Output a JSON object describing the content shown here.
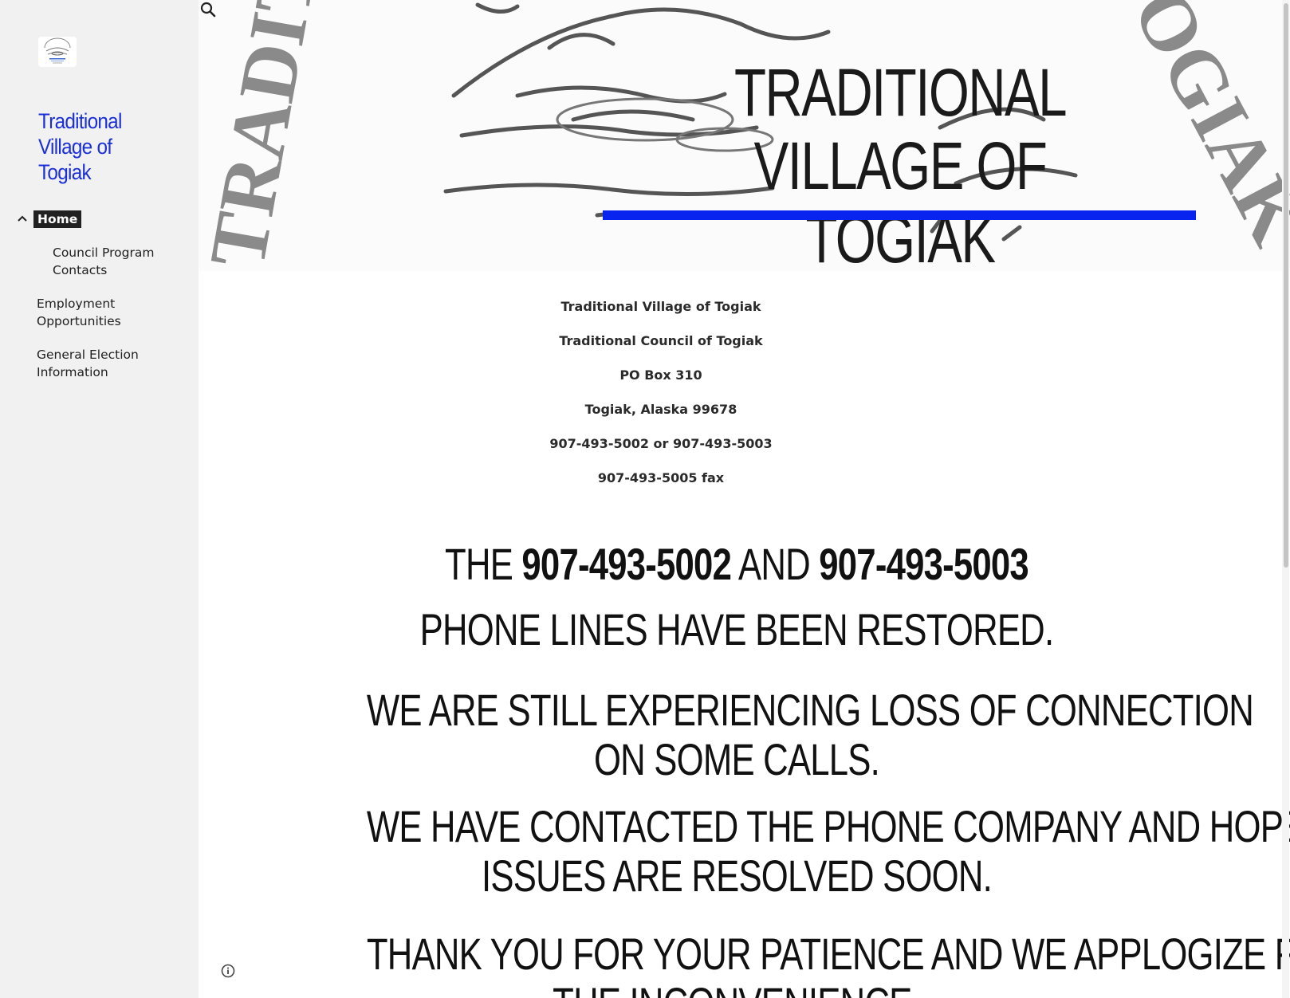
{
  "sidebar": {
    "logo_text": "TRADITIONAL COUNCIL OF TOGIAK",
    "site_title": "Traditional Village of Togiak",
    "nav": {
      "home": "Home",
      "council": "Council Program Contacts",
      "employment": "Employment Opportunities",
      "election": "General Election Information"
    }
  },
  "hero": {
    "title": "TRADITIONAL VILLAGE OF TOGIAK",
    "background_seal_text": "TRADITIONAL COUNCIL OF TOGIAK",
    "accent_color": "#0a24f0"
  },
  "address": {
    "line1": "Traditional Village of Togiak",
    "line2": "Traditional Council of Togiak",
    "line3": "PO Box 310",
    "line4": "Togiak, Alaska 99678",
    "line5": "907-493-5002 or 907-493-5003",
    "line6": "907-493-5005 fax"
  },
  "notice": {
    "p1_the": "THE ",
    "p1_phone1": "907-493-5002",
    "p1_and": " AND ",
    "p1_phone2": "907-493-5003",
    "p2": "PHONE LINES HAVE BEEN RESTORED.",
    "p3_line1": "WE ARE STILL EXPERIENCING LOSS OF CONNECTION",
    "p3_line2": "ON SOME CALLS.",
    "p4_line1": "WE HAVE CONTACTED THE PHONE COMPANY AND HOPE THE",
    "p4_line2": "ISSUES ARE RESOLVED SOON.",
    "p5_line1": "THANK YOU FOR YOUR PATIENCE AND WE APPLOGIZE FOR",
    "p5_line2": "THE INCONVENIENCE."
  },
  "icons": {
    "search": "search-icon",
    "chevron": "chevron-up-icon",
    "info": "info-icon"
  }
}
